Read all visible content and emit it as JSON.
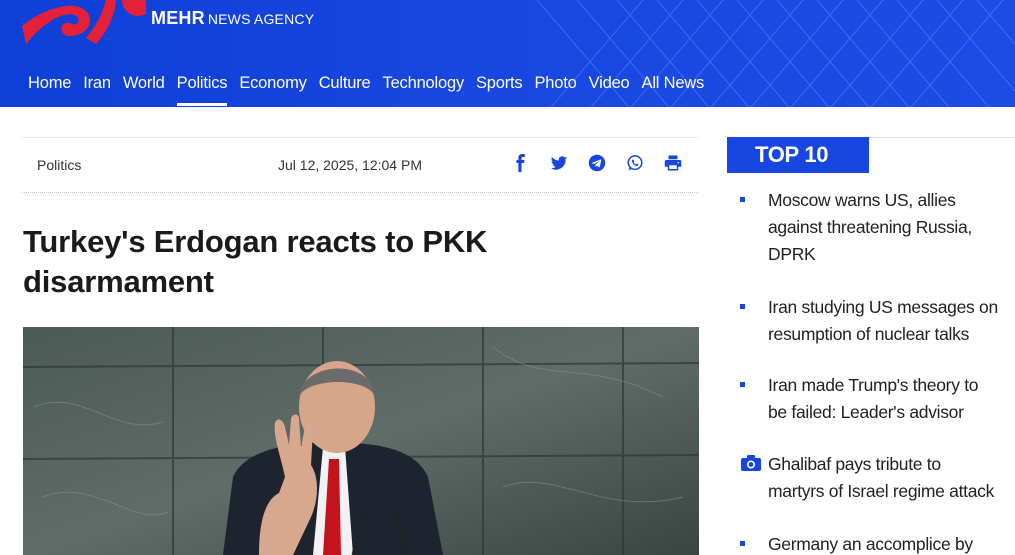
{
  "brand": {
    "strong": "MEHR",
    "light": "NEWS AGENCY"
  },
  "nav": [
    "Home",
    "Iran",
    "World",
    "Politics",
    "Economy",
    "Culture",
    "Technology",
    "Sports",
    "Photo",
    "Video",
    "All News"
  ],
  "nav_active": "Politics",
  "article": {
    "section": "Politics",
    "date": "Jul 12, 2025, 12:04 PM",
    "headline": "Turkey's Erdogan reacts to PKK\ndisarmament"
  },
  "share_icons": [
    "facebook-icon",
    "twitter-icon",
    "telegram-icon",
    "whatsapp-icon",
    "print-icon"
  ],
  "top10": {
    "title": "TOP 10",
    "items": [
      {
        "text": "Moscow warns US, allies\nagainst threatening Russia,\nDPRK",
        "icon": "bullet"
      },
      {
        "text": "Iran studying US messages on\nresumption of nuclear talks",
        "icon": "bullet"
      },
      {
        "text": "Iran made Trump's theory to\nbe failed: Leader's advisor",
        "icon": "bullet"
      },
      {
        "text": "Ghalibaf pays tribute to\nmartyrs of Israel regime attack",
        "icon": "camera-icon"
      },
      {
        "text": "Germany an accomplice by",
        "icon": "bullet"
      }
    ]
  },
  "colors": {
    "brand_blue": "#1746e0",
    "logo_red": "#e5213a"
  }
}
